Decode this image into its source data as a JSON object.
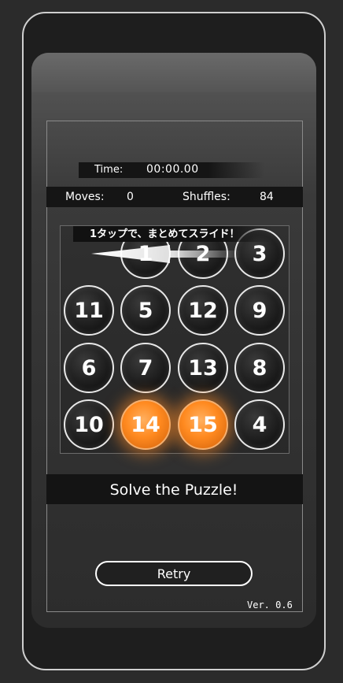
{
  "header": {
    "time_label": "Time:",
    "time_value": "00:00.00"
  },
  "stats": {
    "moves_label": "Moves:",
    "moves_value": "0",
    "shuffles_label": "Shuffles:",
    "shuffles_value": "84"
  },
  "hint": "1タップで、まとめてスライド！",
  "board": {
    "rows": [
      [
        "",
        "1",
        "2",
        "3"
      ],
      [
        "11",
        "5",
        "12",
        "9"
      ],
      [
        "6",
        "7",
        "13",
        "8"
      ],
      [
        "10",
        "14",
        "15",
        "4"
      ]
    ],
    "highlighted_tiles": [
      "14",
      "15"
    ],
    "highlight_color": "#ff8a20"
  },
  "status_text": "Solve the Puzzle!",
  "retry_label": "Retry",
  "version": "Ver. 0.6"
}
